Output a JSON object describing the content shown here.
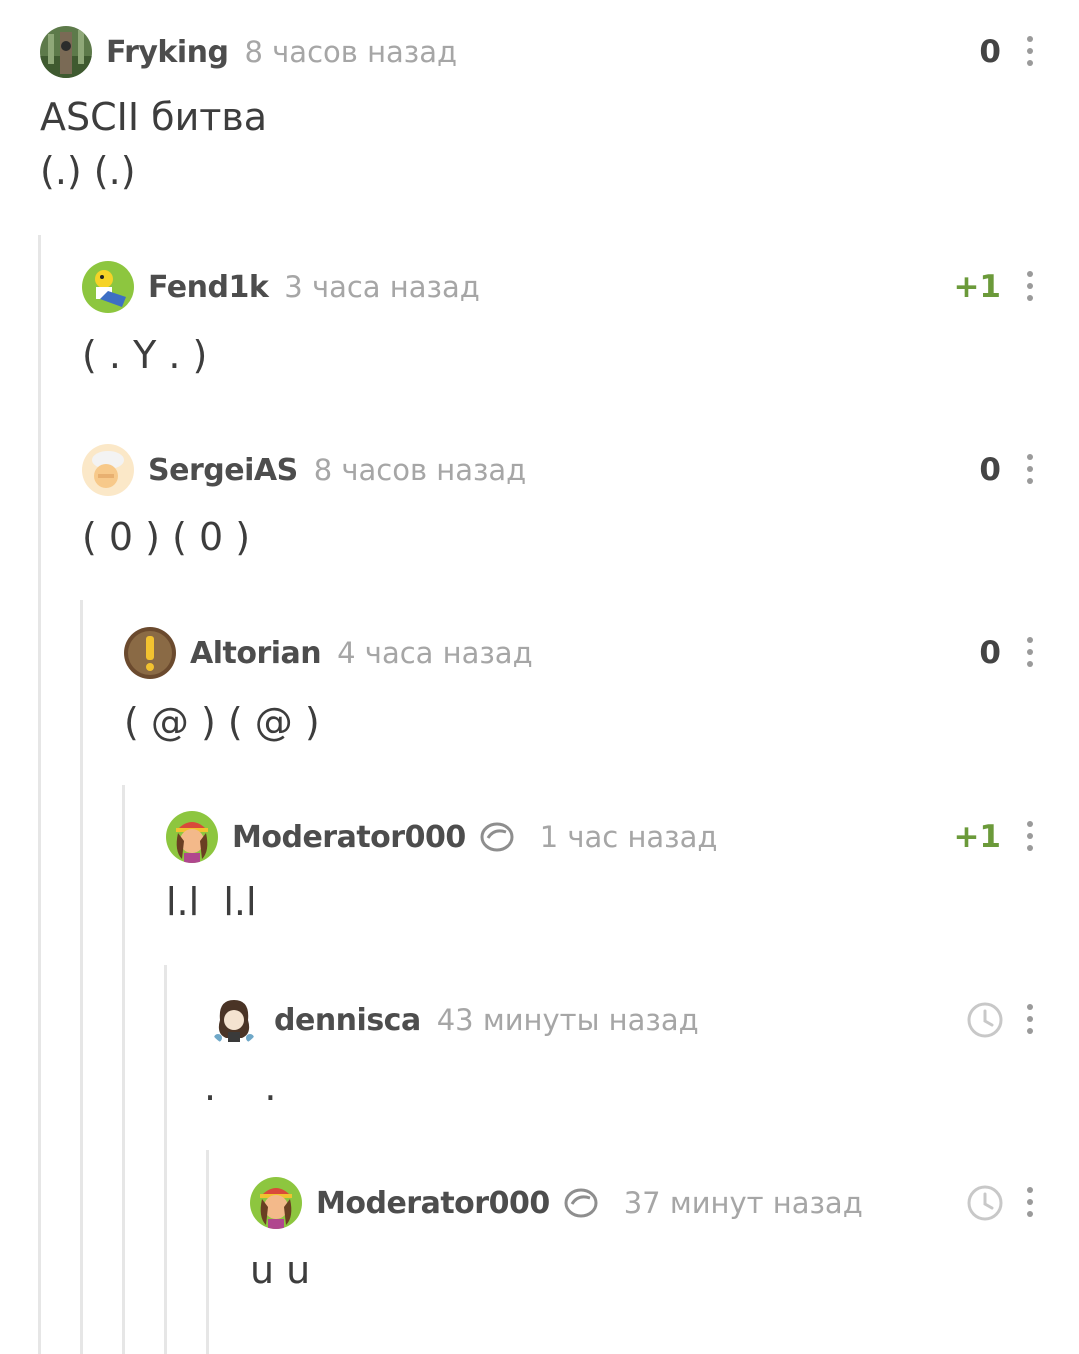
{
  "comments": [
    {
      "username": "Fryking",
      "time": "8 часов назад",
      "rating": "0",
      "text_lines": [
        "ASCII битва",
        "(.) (.)"
      ]
    },
    {
      "username": "Fend1k",
      "time": "3 часа назад",
      "rating": "+1",
      "text_lines": [
        "( . Y . )"
      ]
    },
    {
      "username": "SergeiAS",
      "time": "8 часов назад",
      "rating": "0",
      "text_lines": [
        "( 0 ) ( 0 )"
      ]
    },
    {
      "username": "Altorian",
      "time": "4 часа назад",
      "rating": "0",
      "text_lines": [
        "( @ ) ( @ )"
      ]
    },
    {
      "username": "Moderator000",
      "time": "1 час назад",
      "rating": "+1",
      "moderator": true,
      "text_lines": [
        "l.l  l.l"
      ]
    },
    {
      "username": "dennisca",
      "time": "43 минуты назад",
      "rating_icon": "clock-icon",
      "text_lines": [
        ".    ."
      ]
    },
    {
      "username": "Moderator000",
      "time": "37 минут назад",
      "rating_icon": "clock-icon",
      "moderator": true,
      "text_lines": [
        "u u"
      ]
    }
  ],
  "icons": {
    "more": "more-vertical-icon",
    "moderator": "moderator-badge-icon",
    "pending": "clock-icon"
  },
  "colors": {
    "positive": "#6b9a3a",
    "muted": "#a6a6a6",
    "thread_line": "#e6e6e6"
  }
}
